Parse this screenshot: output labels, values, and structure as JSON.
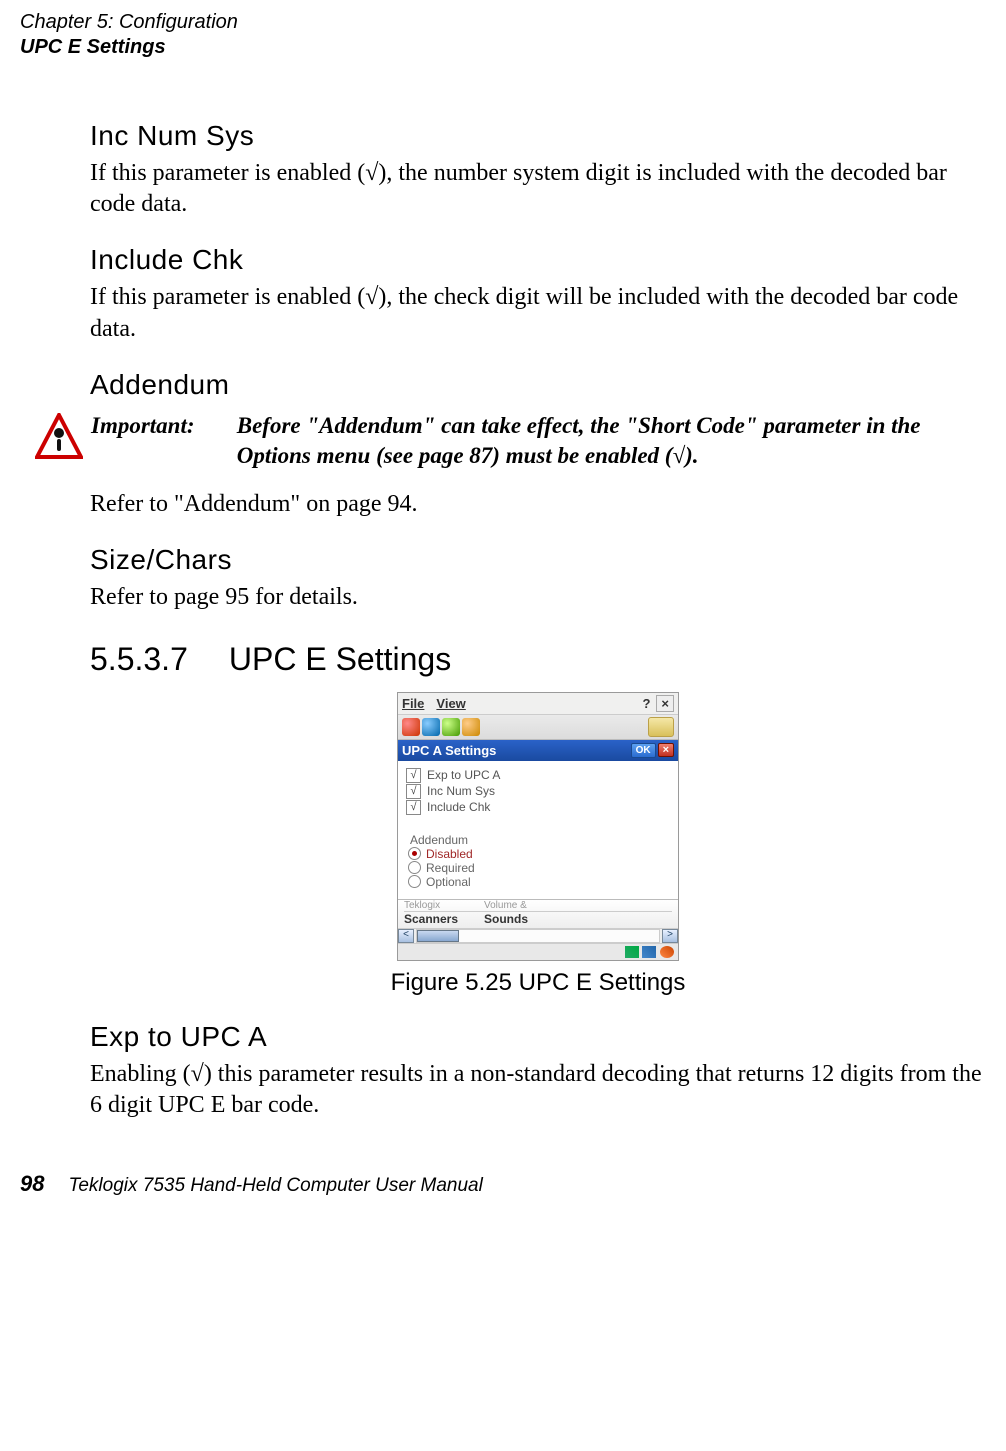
{
  "header": {
    "line1": "Chapter 5: Configuration",
    "line2": "UPC E Settings"
  },
  "sections": {
    "incNumSys": {
      "head": "Inc Num Sys",
      "body": "If this parameter is enabled (√), the number system digit is included with the decoded bar code data."
    },
    "includeChk": {
      "head": "Include Chk",
      "body": "If this parameter is enabled (√), the check digit will be included with the decoded bar code data."
    },
    "addendum": {
      "head": "Addendum",
      "importantLabel": "Important:",
      "importantMsg": "Before \"Addendum\" can take effect, the \"Short Code\" parameter in the Options menu (see page 87) must be enabled (√).",
      "body": "Refer to \"Addendum\" on page 94."
    },
    "sizeChars": {
      "head": "Size/Chars",
      "body": "Refer to page 95 for details."
    },
    "mainSection": {
      "num": "5.5.3.7",
      "title": "UPC E Settings"
    },
    "expToUpcA": {
      "head": "Exp to UPC A",
      "body": "Enabling (√) this parameter results in a non-standard decoding that returns 12 digits from the 6 digit UPC E bar code."
    }
  },
  "figure": {
    "caption": "Figure 5.25 UPC E Settings"
  },
  "device": {
    "menubar": {
      "file": "File",
      "view": "View",
      "help": "?",
      "close": "×"
    },
    "titlebar": {
      "title": "UPC A Settings",
      "ok": "OK",
      "x": "×"
    },
    "checks": [
      {
        "label": "Exp to UPC A",
        "checked": true
      },
      {
        "label": "Inc Num Sys",
        "checked": true
      },
      {
        "label": "Include Chk",
        "checked": true
      }
    ],
    "addendumLabel": "Addendum",
    "radios": [
      {
        "label": "Disabled",
        "selected": true
      },
      {
        "label": "Required",
        "selected": false
      },
      {
        "label": "Optional",
        "selected": false
      }
    ],
    "bottom": {
      "topRow": [
        "Teklogix",
        "Volume &"
      ],
      "botRow": [
        "Scanners",
        "Sounds"
      ]
    }
  },
  "footer": {
    "pagenum": "98",
    "title": "Teklogix 7535 Hand-Held Computer User Manual"
  }
}
